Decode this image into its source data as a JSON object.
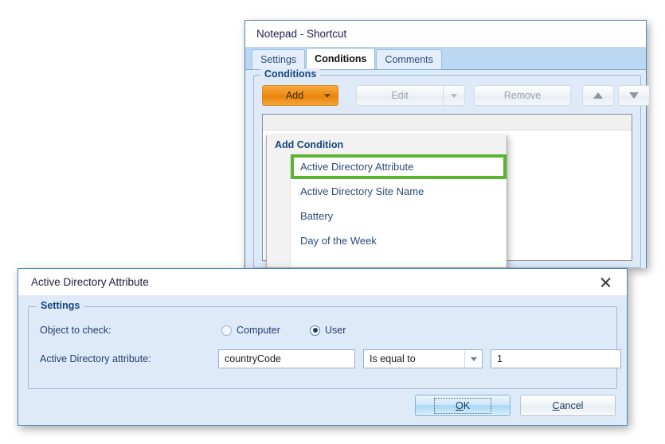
{
  "window": {
    "title": "Notepad - Shortcut",
    "tabs": [
      {
        "label": "Settings",
        "active": false
      },
      {
        "label": "Conditions",
        "active": true
      },
      {
        "label": "Comments",
        "active": false
      }
    ],
    "group_label": "Conditions",
    "toolbar": {
      "add_label": "Add",
      "edit_label": "Edit",
      "remove_label": "Remove",
      "move_up_icon": "triangle-up-icon",
      "move_down_icon": "triangle-down-icon",
      "add_caret_icon": "chevron-down-icon",
      "edit_caret_icon": "chevron-down-icon"
    }
  },
  "menu": {
    "header": "Add Condition",
    "items": [
      {
        "label": "Active Directory Attribute",
        "highlighted": true
      },
      {
        "label": "Active Directory Site Name",
        "highlighted": false
      },
      {
        "label": "Battery",
        "highlighted": false
      },
      {
        "label": "Day of the Week",
        "highlighted": false
      }
    ],
    "highlight_color": "#5cb531"
  },
  "dialog": {
    "title": "Active Directory Attribute",
    "close_icon": "close-icon",
    "group_label": "Settings",
    "object_label": "Object to check:",
    "radios": [
      {
        "label": "Computer",
        "checked": false
      },
      {
        "label": "User",
        "checked": true
      }
    ],
    "attribute_label": "Active Directory attribute:",
    "attribute_value": "countryCode",
    "operator_value": "Is equal to",
    "operator_caret_icon": "chevron-down-icon",
    "value_value": "1",
    "buttons": {
      "ok_accel": "O",
      "ok_rest": "K",
      "cancel_accel": "C",
      "cancel_rest": "ancel"
    }
  },
  "colors": {
    "accent_orange": "#ef8b16",
    "title_blue": "#16457e",
    "highlight_green": "#5cb531",
    "window_border": "#4a86b8"
  }
}
